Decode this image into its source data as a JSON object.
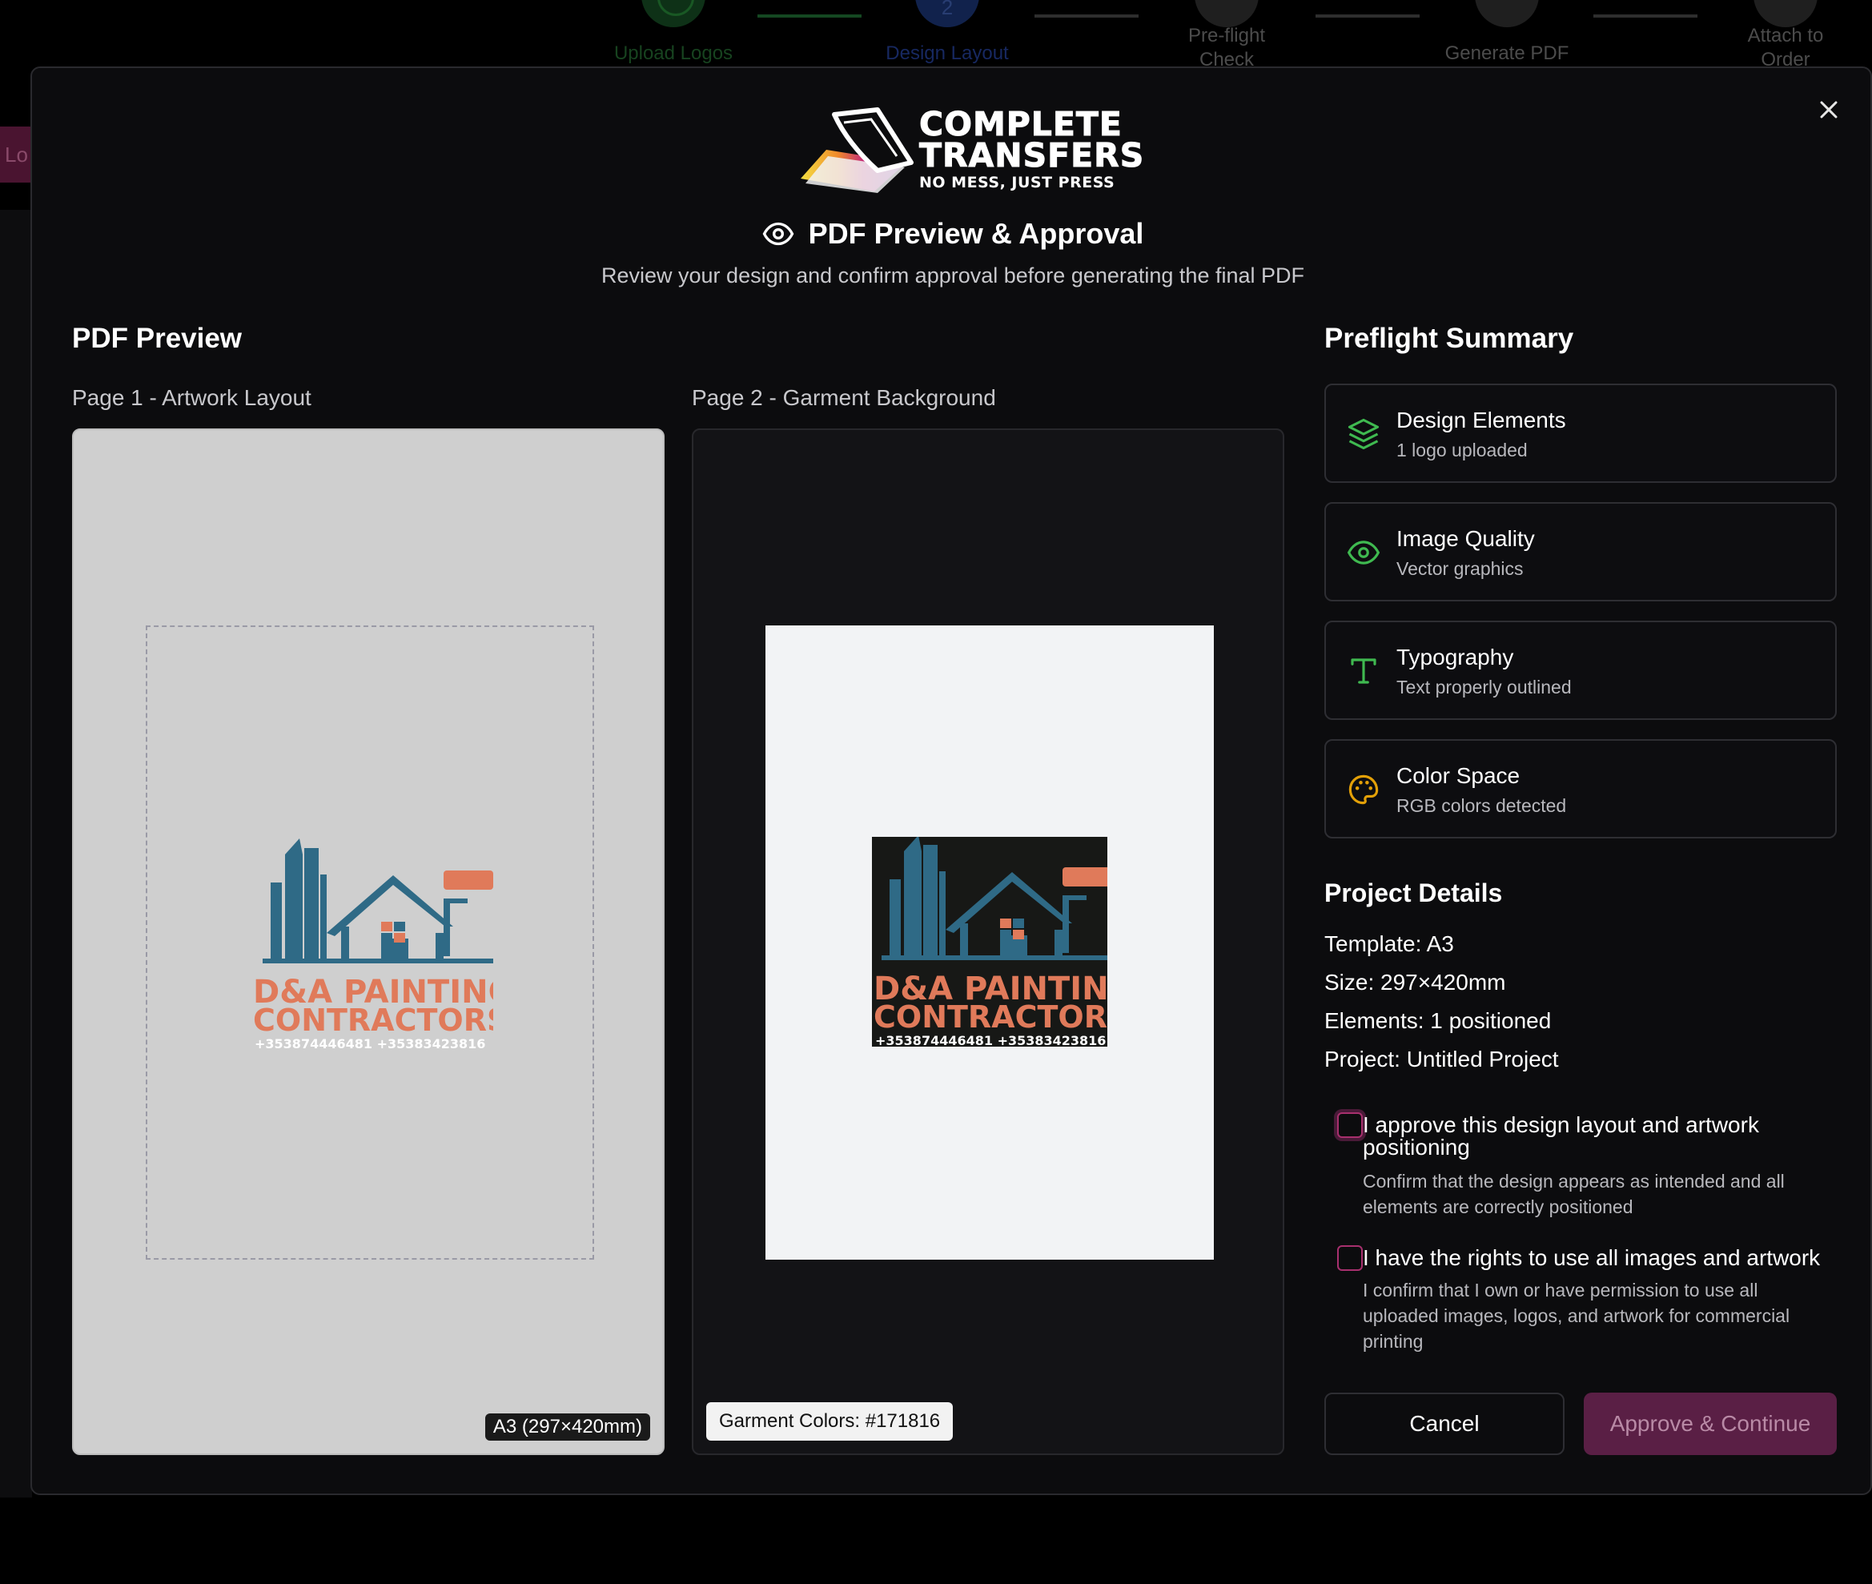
{
  "stepper": {
    "steps": [
      {
        "label": "Upload Logos",
        "state": "done"
      },
      {
        "label": "Design Layout",
        "state": "active",
        "number": "2"
      },
      {
        "label": "Pre-flight Check",
        "state": "pending"
      },
      {
        "label": "Generate PDF",
        "state": "pending"
      },
      {
        "label": "Attach to Order",
        "state": "pending"
      }
    ]
  },
  "background_tab": "Lo",
  "brand": {
    "line1": "COMPLETE",
    "line2": "TRANSFERS",
    "tagline": "NO MESS, JUST PRESS"
  },
  "header": {
    "title": "PDF Preview & Approval",
    "subtitle": "Review your design and confirm approval before generating the final PDF"
  },
  "preview": {
    "heading": "PDF Preview",
    "page1_label": "Page 1 - Artwork Layout",
    "page2_label": "Page 2 - Garment Background",
    "size_badge": "A3 (297×420mm)",
    "garment_badge": "Garment Colors: #171816",
    "artwork": {
      "line1": "D&A PAINTING",
      "line2": "CONTRACTORS",
      "phones": "+353874446481  +35383423816",
      "colors": {
        "blue": "#2f6a86",
        "orange": "#e07a5a",
        "garment": "#171816"
      }
    }
  },
  "preflight": {
    "heading": "Preflight Summary",
    "items": [
      {
        "title": "Design Elements",
        "sub": "1 logo uploaded",
        "icon": "layers-icon",
        "color": "#3fb950"
      },
      {
        "title": "Image Quality",
        "sub": "Vector graphics",
        "icon": "eye-icon",
        "color": "#3fb950"
      },
      {
        "title": "Typography",
        "sub": "Text properly outlined",
        "icon": "type-icon",
        "color": "#3fb950"
      },
      {
        "title": "Color Space",
        "sub": "RGB colors detected",
        "icon": "palette-icon",
        "color": "#e3a008"
      }
    ]
  },
  "project": {
    "heading": "Project Details",
    "template": "Template: A3",
    "size": "Size: 297×420mm",
    "elements": "Elements: 1 positioned",
    "project": "Project: Untitled Project"
  },
  "approvals": [
    {
      "label": "I approve this design layout and artwork positioning",
      "desc": "Confirm that the design appears as intended and all elements are correctly positioned",
      "checked": false
    },
    {
      "label": "I have the rights to use all images and artwork",
      "desc": "I confirm that I own or have permission to use all uploaded images, logos, and artwork for commercial printing",
      "checked": false
    }
  ],
  "buttons": {
    "cancel": "Cancel",
    "approve": "Approve & Continue"
  }
}
